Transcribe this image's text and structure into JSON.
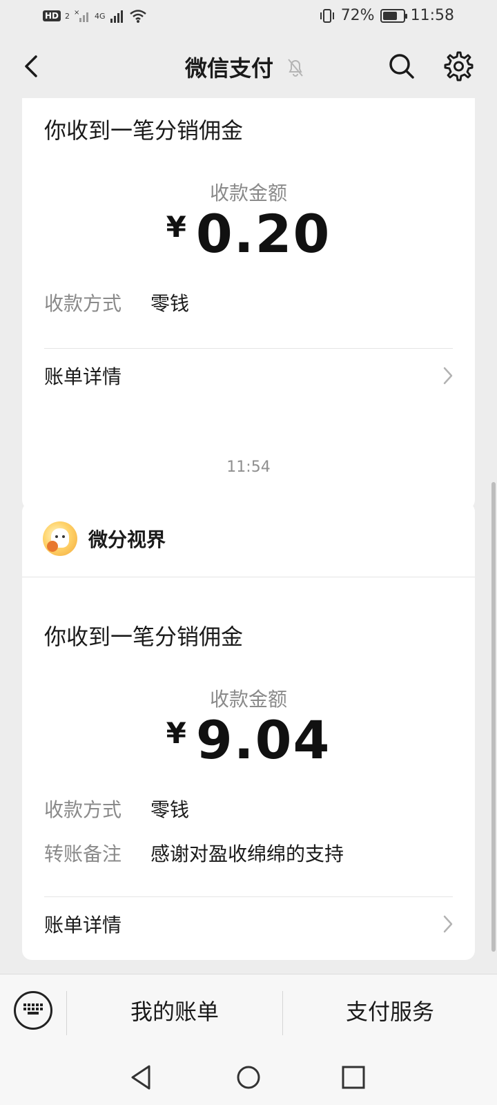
{
  "status_bar": {
    "hd_badge": "HD",
    "hd_sub": "2",
    "network": "4G",
    "battery_percent": "72%",
    "battery_level": 0.72,
    "time": "11:58"
  },
  "nav": {
    "title": "微信支付"
  },
  "messages": [
    {
      "heading": "你收到一笔分销佣金",
      "amount_label": "收款金额",
      "currency": "¥",
      "amount": "0.20",
      "rows": [
        {
          "key": "收款方式",
          "value": "零钱"
        }
      ],
      "detail_label": "账单详情"
    },
    {
      "timestamp": "11:54",
      "merchant": "微分视界",
      "heading": "你收到一笔分销佣金",
      "amount_label": "收款金额",
      "currency": "¥",
      "amount": "9.04",
      "rows": [
        {
          "key": "收款方式",
          "value": "零钱"
        },
        {
          "key": "转账备注",
          "value": "感谢对盈收绵绵的支持"
        }
      ],
      "detail_label": "账单详情"
    }
  ],
  "bottom_menu": {
    "items": [
      "我的账单",
      "支付服务"
    ]
  },
  "colors": {
    "background": "#ededed",
    "card": "#ffffff",
    "muted_text": "#8a8a8a"
  }
}
